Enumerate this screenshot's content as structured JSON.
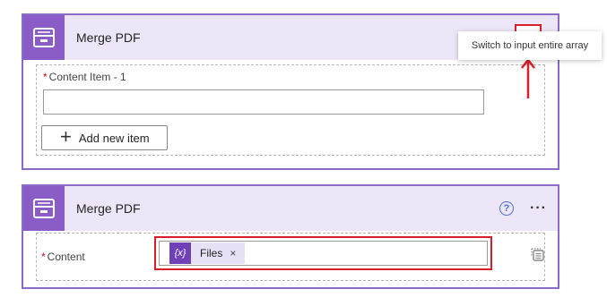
{
  "tooltip": "Switch to input entire array",
  "card1": {
    "title": "Merge PDF",
    "field_label": "Content Item - 1",
    "input_value": "",
    "add_button": "Add new item"
  },
  "card2": {
    "title": "Merge PDF",
    "help_glyph": "?",
    "more_glyph": "···",
    "field_label": "Content",
    "token_icon_text": "{x}",
    "token_label": "Files",
    "token_close": "×"
  },
  "required_mark": "*",
  "colors": {
    "card_border": "#8a6cc8",
    "header_bg": "#ece6f8",
    "icon_bg": "#8a5cc8",
    "highlight_red": "#d81e2a",
    "token_bg": "#e8e0f5",
    "token_icon_bg": "#7040b8"
  },
  "icons": [
    "connector-icon",
    "switch-array-icon",
    "help-icon",
    "more-icon",
    "variable-icon",
    "close-icon",
    "plus-icon",
    "arrow-up-icon"
  ]
}
